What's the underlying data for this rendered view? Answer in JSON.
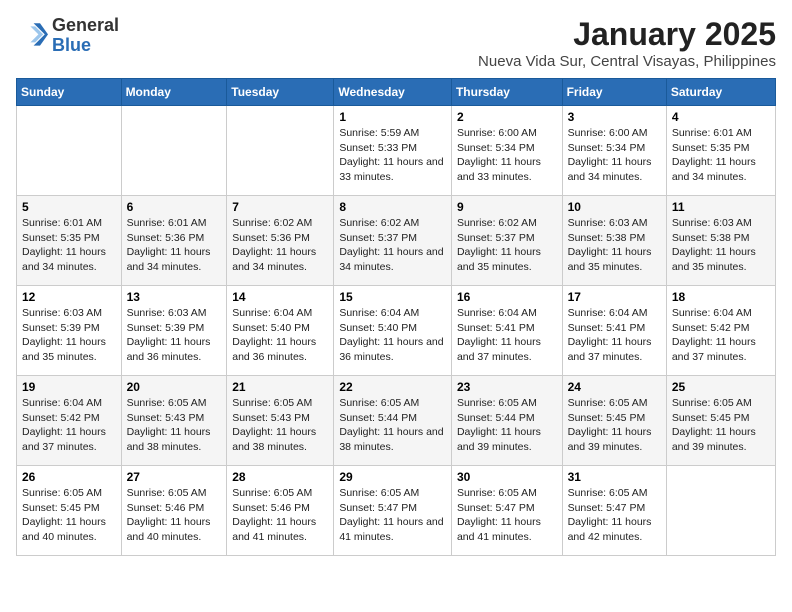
{
  "header": {
    "logo_line1": "General",
    "logo_line2": "Blue",
    "month": "January 2025",
    "location": "Nueva Vida Sur, Central Visayas, Philippines"
  },
  "weekdays": [
    "Sunday",
    "Monday",
    "Tuesday",
    "Wednesday",
    "Thursday",
    "Friday",
    "Saturday"
  ],
  "weeks": [
    [
      {
        "day": "",
        "sunrise": "",
        "sunset": "",
        "daylight": ""
      },
      {
        "day": "",
        "sunrise": "",
        "sunset": "",
        "daylight": ""
      },
      {
        "day": "",
        "sunrise": "",
        "sunset": "",
        "daylight": ""
      },
      {
        "day": "1",
        "sunrise": "Sunrise: 5:59 AM",
        "sunset": "Sunset: 5:33 PM",
        "daylight": "Daylight: 11 hours and 33 minutes."
      },
      {
        "day": "2",
        "sunrise": "Sunrise: 6:00 AM",
        "sunset": "Sunset: 5:34 PM",
        "daylight": "Daylight: 11 hours and 33 minutes."
      },
      {
        "day": "3",
        "sunrise": "Sunrise: 6:00 AM",
        "sunset": "Sunset: 5:34 PM",
        "daylight": "Daylight: 11 hours and 34 minutes."
      },
      {
        "day": "4",
        "sunrise": "Sunrise: 6:01 AM",
        "sunset": "Sunset: 5:35 PM",
        "daylight": "Daylight: 11 hours and 34 minutes."
      }
    ],
    [
      {
        "day": "5",
        "sunrise": "Sunrise: 6:01 AM",
        "sunset": "Sunset: 5:35 PM",
        "daylight": "Daylight: 11 hours and 34 minutes."
      },
      {
        "day": "6",
        "sunrise": "Sunrise: 6:01 AM",
        "sunset": "Sunset: 5:36 PM",
        "daylight": "Daylight: 11 hours and 34 minutes."
      },
      {
        "day": "7",
        "sunrise": "Sunrise: 6:02 AM",
        "sunset": "Sunset: 5:36 PM",
        "daylight": "Daylight: 11 hours and 34 minutes."
      },
      {
        "day": "8",
        "sunrise": "Sunrise: 6:02 AM",
        "sunset": "Sunset: 5:37 PM",
        "daylight": "Daylight: 11 hours and 34 minutes."
      },
      {
        "day": "9",
        "sunrise": "Sunrise: 6:02 AM",
        "sunset": "Sunset: 5:37 PM",
        "daylight": "Daylight: 11 hours and 35 minutes."
      },
      {
        "day": "10",
        "sunrise": "Sunrise: 6:03 AM",
        "sunset": "Sunset: 5:38 PM",
        "daylight": "Daylight: 11 hours and 35 minutes."
      },
      {
        "day": "11",
        "sunrise": "Sunrise: 6:03 AM",
        "sunset": "Sunset: 5:38 PM",
        "daylight": "Daylight: 11 hours and 35 minutes."
      }
    ],
    [
      {
        "day": "12",
        "sunrise": "Sunrise: 6:03 AM",
        "sunset": "Sunset: 5:39 PM",
        "daylight": "Daylight: 11 hours and 35 minutes."
      },
      {
        "day": "13",
        "sunrise": "Sunrise: 6:03 AM",
        "sunset": "Sunset: 5:39 PM",
        "daylight": "Daylight: 11 hours and 36 minutes."
      },
      {
        "day": "14",
        "sunrise": "Sunrise: 6:04 AM",
        "sunset": "Sunset: 5:40 PM",
        "daylight": "Daylight: 11 hours and 36 minutes."
      },
      {
        "day": "15",
        "sunrise": "Sunrise: 6:04 AM",
        "sunset": "Sunset: 5:40 PM",
        "daylight": "Daylight: 11 hours and 36 minutes."
      },
      {
        "day": "16",
        "sunrise": "Sunrise: 6:04 AM",
        "sunset": "Sunset: 5:41 PM",
        "daylight": "Daylight: 11 hours and 37 minutes."
      },
      {
        "day": "17",
        "sunrise": "Sunrise: 6:04 AM",
        "sunset": "Sunset: 5:41 PM",
        "daylight": "Daylight: 11 hours and 37 minutes."
      },
      {
        "day": "18",
        "sunrise": "Sunrise: 6:04 AM",
        "sunset": "Sunset: 5:42 PM",
        "daylight": "Daylight: 11 hours and 37 minutes."
      }
    ],
    [
      {
        "day": "19",
        "sunrise": "Sunrise: 6:04 AM",
        "sunset": "Sunset: 5:42 PM",
        "daylight": "Daylight: 11 hours and 37 minutes."
      },
      {
        "day": "20",
        "sunrise": "Sunrise: 6:05 AM",
        "sunset": "Sunset: 5:43 PM",
        "daylight": "Daylight: 11 hours and 38 minutes."
      },
      {
        "day": "21",
        "sunrise": "Sunrise: 6:05 AM",
        "sunset": "Sunset: 5:43 PM",
        "daylight": "Daylight: 11 hours and 38 minutes."
      },
      {
        "day": "22",
        "sunrise": "Sunrise: 6:05 AM",
        "sunset": "Sunset: 5:44 PM",
        "daylight": "Daylight: 11 hours and 38 minutes."
      },
      {
        "day": "23",
        "sunrise": "Sunrise: 6:05 AM",
        "sunset": "Sunset: 5:44 PM",
        "daylight": "Daylight: 11 hours and 39 minutes."
      },
      {
        "day": "24",
        "sunrise": "Sunrise: 6:05 AM",
        "sunset": "Sunset: 5:45 PM",
        "daylight": "Daylight: 11 hours and 39 minutes."
      },
      {
        "day": "25",
        "sunrise": "Sunrise: 6:05 AM",
        "sunset": "Sunset: 5:45 PM",
        "daylight": "Daylight: 11 hours and 39 minutes."
      }
    ],
    [
      {
        "day": "26",
        "sunrise": "Sunrise: 6:05 AM",
        "sunset": "Sunset: 5:45 PM",
        "daylight": "Daylight: 11 hours and 40 minutes."
      },
      {
        "day": "27",
        "sunrise": "Sunrise: 6:05 AM",
        "sunset": "Sunset: 5:46 PM",
        "daylight": "Daylight: 11 hours and 40 minutes."
      },
      {
        "day": "28",
        "sunrise": "Sunrise: 6:05 AM",
        "sunset": "Sunset: 5:46 PM",
        "daylight": "Daylight: 11 hours and 41 minutes."
      },
      {
        "day": "29",
        "sunrise": "Sunrise: 6:05 AM",
        "sunset": "Sunset: 5:47 PM",
        "daylight": "Daylight: 11 hours and 41 minutes."
      },
      {
        "day": "30",
        "sunrise": "Sunrise: 6:05 AM",
        "sunset": "Sunset: 5:47 PM",
        "daylight": "Daylight: 11 hours and 41 minutes."
      },
      {
        "day": "31",
        "sunrise": "Sunrise: 6:05 AM",
        "sunset": "Sunset: 5:47 PM",
        "daylight": "Daylight: 11 hours and 42 minutes."
      },
      {
        "day": "",
        "sunrise": "",
        "sunset": "",
        "daylight": ""
      }
    ]
  ]
}
